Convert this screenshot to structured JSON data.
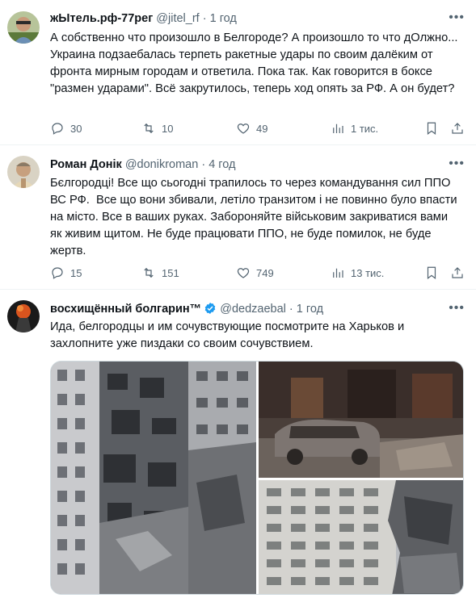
{
  "tweets": [
    {
      "name": "жЫтель.рф-77рег",
      "handle": "@jitel_rf",
      "dot": "·",
      "time": "1 год",
      "text": "А собственно что произошло в Белгороде? А произошло то что дОлжно... Украина подзаебалась терпеть ракетные удары по своим далёким от фронта мирным городам и ответила. Пока так. Как говорится в боксе \"размен ударами\". Всё закрутилось, теперь ход опять за РФ. А он будет?",
      "replies": "30",
      "retweets": "10",
      "likes": "49",
      "views": "1 тис."
    },
    {
      "name": "Роман Донік",
      "handle": "@donikroman",
      "dot": "·",
      "time": "4 год",
      "text": "Бєлгородці! Все що сьогодні трапилось то через командування сил ППО ВС РФ.  Все що вони збивали, летіло транзитом і не повинно було впасти на місто. Все в ваших руках. Забороняйте військовим закриватися вами як живим щитом. Не буде працювати ППО, не буде помилок, не буде жертв.",
      "replies": "15",
      "retweets": "151",
      "likes": "749",
      "views": "13 тис."
    },
    {
      "name": "восхищённый болгарин™",
      "handle": "@dedzaebal",
      "dot": "·",
      "time": "1 год",
      "text": "Ида, белгородцы и им сочувствующие посмотрите на Харьков и захлопните уже пиздаки со своим сочувствием."
    }
  ],
  "colors": {
    "text": "#0f1419",
    "secondary": "#536471",
    "verified": "#1d9bf0",
    "divider": "#eff3f4"
  },
  "icons": [
    "reply-icon",
    "retweet-icon",
    "like-icon",
    "views-icon",
    "bookmark-icon",
    "share-icon",
    "more-icon",
    "verified-badge-icon"
  ]
}
